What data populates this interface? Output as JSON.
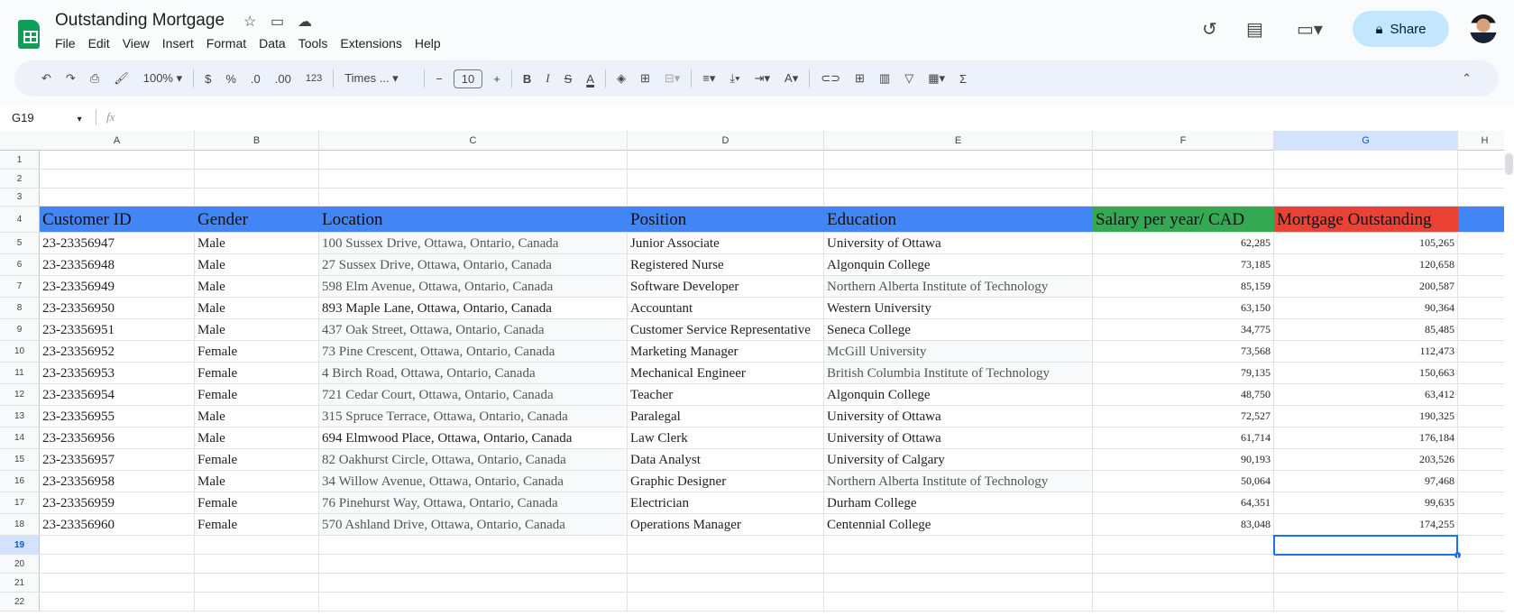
{
  "doc": {
    "title": "Outstanding Mortgage"
  },
  "menu": [
    "File",
    "Edit",
    "View",
    "Insert",
    "Format",
    "Data",
    "Tools",
    "Extensions",
    "Help"
  ],
  "header": {
    "share_label": "Share"
  },
  "toolbar": {
    "zoom": "100%",
    "currency": "$",
    "percent": "%",
    "dec_decrease": ".0",
    "dec_increase": ".00",
    "format_more": "123",
    "font": "Times ...",
    "font_size": "10"
  },
  "formula_bar": {
    "cell_ref": "G19",
    "fx": "fx",
    "value": ""
  },
  "columns": [
    "A",
    "B",
    "C",
    "D",
    "E",
    "F",
    "G",
    "H"
  ],
  "selected_cell": "G19",
  "colors": {
    "header_blue": "#4285f4",
    "header_green": "#34a853",
    "header_red": "#ea4335"
  },
  "table": {
    "headers": [
      "Customer ID",
      "Gender",
      "Location",
      "Position",
      "Education",
      "Salary per year/ CAD",
      "Mortgage Outstanding"
    ],
    "rows": [
      [
        "23-23356947",
        "Male",
        "100 Sussex Drive, Ottawa, Ontario, Canada",
        "Junior Associate",
        "University of Ottawa",
        "62,285",
        "105,265"
      ],
      [
        "23-23356948",
        "Male",
        "27 Sussex Drive, Ottawa, Ontario, Canada",
        "Registered Nurse",
        "Algonquin College",
        "73,185",
        "120,658"
      ],
      [
        "23-23356949",
        "Male",
        "598 Elm Avenue, Ottawa, Ontario, Canada",
        "Software Developer",
        "Northern Alberta Institute of Technology",
        "85,159",
        "200,587"
      ],
      [
        "23-23356950",
        "Male",
        "893 Maple Lane, Ottawa, Ontario, Canada",
        "Accountant",
        "Western University",
        "63,150",
        "90,364"
      ],
      [
        "23-23356951",
        "Male",
        "437 Oak Street, Ottawa, Ontario, Canada",
        "Customer Service Representative",
        "Seneca College",
        "34,775",
        "85,485"
      ],
      [
        "23-23356952",
        "Female",
        "73 Pine Crescent, Ottawa, Ontario, Canada",
        "Marketing Manager",
        "McGill University",
        "73,568",
        "112,473"
      ],
      [
        "23-23356953",
        "Female",
        "4 Birch Road, Ottawa, Ontario, Canada",
        "Mechanical Engineer",
        "British Columbia Institute of Technology",
        "79,135",
        "150,663"
      ],
      [
        "23-23356954",
        "Female",
        "721 Cedar Court, Ottawa, Ontario, Canada",
        "Teacher",
        "Algonquin College",
        "48,750",
        "63,412"
      ],
      [
        "23-23356955",
        "Male",
        "315 Spruce Terrace, Ottawa, Ontario, Canada",
        "Paralegal",
        "University of Ottawa",
        "72,527",
        "190,325"
      ],
      [
        "23-23356956",
        "Male",
        "694 Elmwood Place, Ottawa, Ontario, Canada",
        "Law Clerk",
        "University of Ottawa",
        "61,714",
        "176,184"
      ],
      [
        "23-23356957",
        "Female",
        "82 Oakhurst Circle, Ottawa, Ontario, Canada",
        "Data Analyst",
        "University of Calgary",
        "90,193",
        "203,526"
      ],
      [
        "23-23356958",
        "Male",
        "34 Willow Avenue, Ottawa, Ontario, Canada",
        "Graphic Designer",
        "Northern Alberta Institute of Technology",
        "50,064",
        "97,468"
      ],
      [
        "23-23356959",
        "Female",
        "76 Pinehurst Way, Ottawa, Ontario, Canada",
        "Electrician",
        "Durham College",
        "64,351",
        "99,635"
      ],
      [
        "23-23356960",
        "Female",
        "570 Ashland Drive, Ottawa, Ontario, Canada",
        "Operations Manager",
        "Centennial College",
        "83,048",
        "174,255"
      ]
    ]
  }
}
